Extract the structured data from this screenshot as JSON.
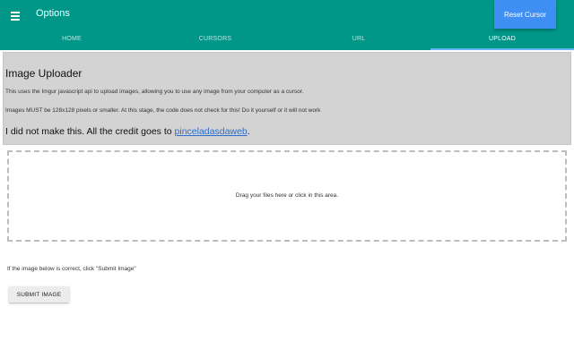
{
  "header": {
    "menu_icon": "hamburger-icon",
    "title": "Options",
    "reset_label": "Reset Cursor"
  },
  "tabs": [
    {
      "label": "HOME",
      "active": false
    },
    {
      "label": "CURSORS",
      "active": false
    },
    {
      "label": "URL",
      "active": false
    },
    {
      "label": "UPLOAD",
      "active": true
    }
  ],
  "uploader": {
    "heading": "Image Uploader",
    "description": "This uses the Imgur javascript api to upload images, allowing you to use any image from your computer as a cursor.",
    "warning": "Images MUST be 128x128 pixels or smaller. At this stage, the code does not check for this! Do it yourself or it will not work",
    "credit_prefix": "I did not make this. All the credit goes to ",
    "credit_link": "pinceladasdaweb",
    "credit_suffix": "."
  },
  "dropzone": {
    "text": "Drag your files here or click in this area."
  },
  "submit": {
    "instruction": "If the image below is correct, click \"Submit Image\"",
    "button_label": "SUBMIT IMAGE"
  },
  "colors": {
    "appbar": "#009688",
    "accent": "#3f8ef3",
    "panel": "#d3d3d3",
    "link": "#2b6dcc"
  }
}
